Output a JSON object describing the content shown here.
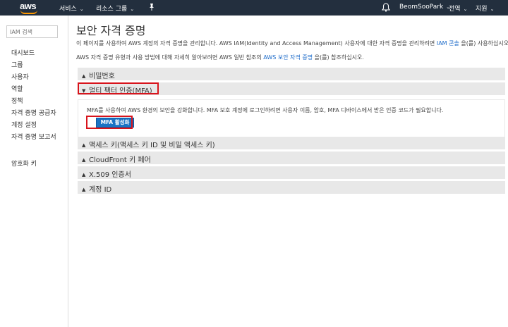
{
  "topbar": {
    "logo_text": "aws",
    "nav_services": "서비스",
    "nav_resource_groups": "리소스 그룹",
    "account": "BeomSooPark",
    "region": "전역",
    "support": "지원"
  },
  "sidebar": {
    "search_placeholder": "IAM 검색",
    "items": [
      "대시보드",
      "그룹",
      "사용자",
      "역할",
      "정책",
      "자격 증명 공급자",
      "계정 설정",
      "자격 증명 보고서"
    ],
    "encryption_keys": "암호화 키"
  },
  "main": {
    "title": "보안 자격 증명",
    "desc1_a": "이 페이지를 사용하여 AWS 계정의 자격 증명을 관리합니다. AWS IAM(Identity and Access Management) 사용자에 대한 자격 증명을 관리하려면 ",
    "desc1_link": "IAM 콘솔",
    "desc1_b": " 을(를) 사용하십시오.",
    "desc2_a": "AWS 자격 증명 유형과 사용 방법에 대해 자세히 알아보려면 AWS 일반 참조의 ",
    "desc2_link": "AWS 보안 자격 증명",
    "desc2_b": " 을(를) 참조하십시오.",
    "sections": {
      "password": "비밀번호",
      "mfa": "멀티 팩터 인증(MFA)",
      "access_keys": "액세스 키(액세스 키 ID 및 비밀 액세스 키)",
      "cloudfront": "CloudFront 키 페어",
      "x509": "X.509 인증서",
      "account_id": "계정 ID"
    },
    "mfa_desc": "MFA를 사용하여 AWS 환경의 보안을 강화합니다. MFA 보호 계정에 로그인하려면 사용자 이름, 암호, MFA 디바이스에서 받은 인증 코드가 필요합니다.",
    "mfa_button": "MFA 활성화"
  },
  "colors": {
    "topbar": "#232f3e",
    "highlight": "#d8141c",
    "button": "#1a73c4",
    "link": "#1b6ac9"
  }
}
